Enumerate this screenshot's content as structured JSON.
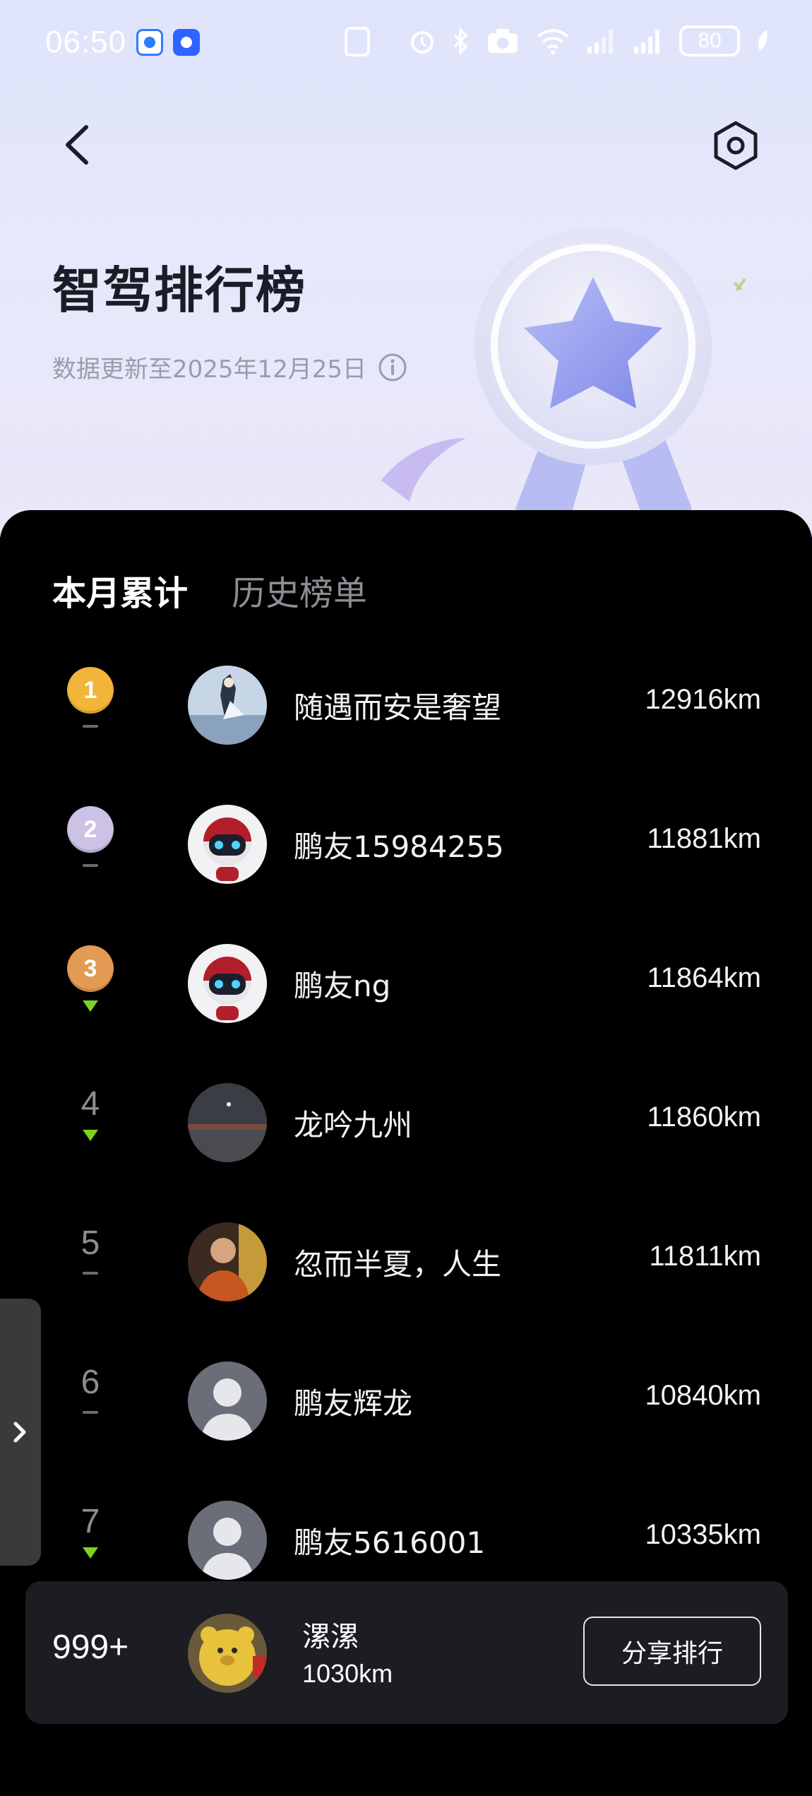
{
  "status_bar": {
    "time": "06:50",
    "battery": "80"
  },
  "header": {
    "title": "智驾排行榜",
    "update_text": "数据更新至2025年12月25日"
  },
  "tabs": [
    {
      "label": "本月累计",
      "active": true
    },
    {
      "label": "历史榜单",
      "active": false
    }
  ],
  "ranking": [
    {
      "rank": "1",
      "name": "随遇而安是奢望",
      "distance": "12916km",
      "trend": "flat",
      "medal_color": "#f2b53a",
      "avatar": "anime-character"
    },
    {
      "rank": "2",
      "name": "鹏友15984255",
      "distance": "11881km",
      "trend": "flat",
      "medal_color": "#cbc2e6",
      "avatar": "robot"
    },
    {
      "rank": "3",
      "name": "鹏友ng",
      "distance": "11864km",
      "trend": "down",
      "medal_color": "#e39a52",
      "avatar": "robot"
    },
    {
      "rank": "4",
      "name": "龙吟九州",
      "distance": "11860km",
      "trend": "down",
      "avatar": "night-sky"
    },
    {
      "rank": "5",
      "name": "忽而半夏，人生",
      "distance": "11811km",
      "trend": "flat",
      "avatar": "monk"
    },
    {
      "rank": "6",
      "name": "鹏友辉龙",
      "distance": "10840km",
      "trend": "flat",
      "avatar": "default"
    },
    {
      "rank": "7",
      "name": "鹏友5616001",
      "distance": "10335km",
      "trend": "down",
      "avatar": "default"
    }
  ],
  "my_rank": {
    "rank": "999+",
    "name": "漯漯",
    "distance": "1030km",
    "share_label": "分享排行"
  },
  "colors": {
    "trend_down": "#7ed321",
    "panel_bg": "#000000",
    "card_bg": "#1c1d22"
  }
}
